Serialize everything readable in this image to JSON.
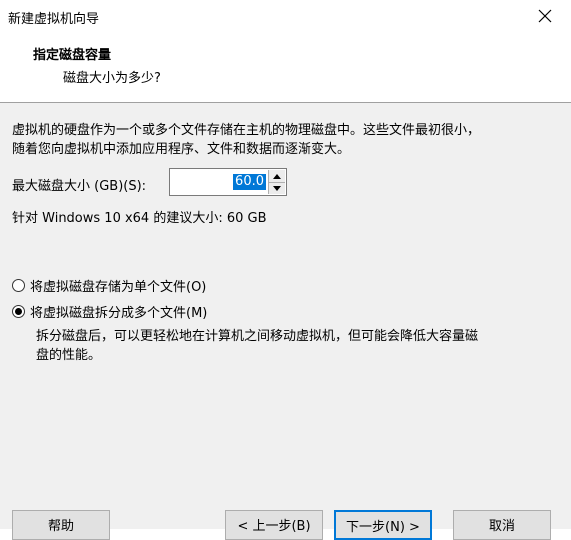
{
  "window": {
    "title": "新建虚拟机向导",
    "close_glyph": "✕"
  },
  "header": {
    "title": "指定磁盘容量",
    "subtitle": "磁盘大小为多少?"
  },
  "content": {
    "intro_line1": "虚拟机的硬盘作为一个或多个文件存储在主机的物理磁盘中。这些文件最初很小，",
    "intro_line2": "随着您向虚拟机中添加应用程序、文件和数据而逐渐变大。",
    "size_label": "最大磁盘大小 (GB)(S):",
    "size_value": "60.0",
    "recommend": "针对 Windows 10 x64 的建议大小: 60 GB",
    "radio_single": "将虚拟磁盘存储为单个文件(O)",
    "radio_multi": "将虚拟磁盘拆分成多个文件(M)",
    "radio_selected": "multi",
    "desc_line1": "拆分磁盘后，可以更轻松地在计算机之间移动虚拟机，但可能会降低大容量磁",
    "desc_line2": "盘的性能。"
  },
  "footer": {
    "help": "帮助",
    "back": "< 上一步(B)",
    "next": "下一步(N) >",
    "cancel": "取消"
  },
  "colors": {
    "accent": "#0078d7",
    "panel": "#f0f0f0"
  }
}
